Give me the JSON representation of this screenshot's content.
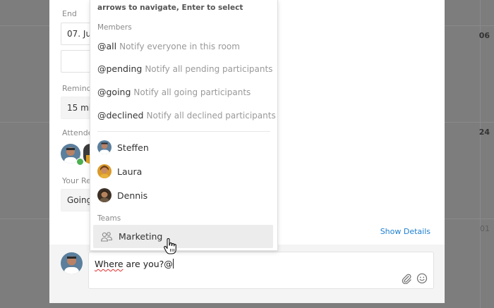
{
  "background": {
    "days": [
      "06",
      "24",
      "01"
    ]
  },
  "form": {
    "end_label": "End",
    "end_value": "07. Ju",
    "reminder_label": "Reminde",
    "reminder_value": "15 mi",
    "attendees_label": "Attende",
    "response_label": "Your Res",
    "response_value": "Going",
    "show_details": "Show Details"
  },
  "dropdown": {
    "hint": "arrows to navigate, Enter to select",
    "members_title": "Members",
    "commands": [
      {
        "key": "@all",
        "desc": "Notify everyone in this room"
      },
      {
        "key": "@pending",
        "desc": "Notify all pending participants"
      },
      {
        "key": "@going",
        "desc": "Notify all going participants"
      },
      {
        "key": "@declined",
        "desc": "Notify all declined participants"
      }
    ],
    "members": [
      {
        "name": "Steffen"
      },
      {
        "name": "Laura"
      },
      {
        "name": "Dennis"
      }
    ],
    "teams_title": "Teams",
    "team": {
      "name": "Marketing"
    }
  },
  "composer": {
    "word": "Where",
    "rest": " are you?@"
  },
  "colors": {
    "accent": "#1e7fd0",
    "check": "#4caf50",
    "overlay": "#7d7d7d"
  },
  "icons": {
    "attach": "paperclip-icon",
    "emoji": "smiley-icon",
    "team": "group-icon",
    "pointer": "hand-pointer-icon"
  }
}
